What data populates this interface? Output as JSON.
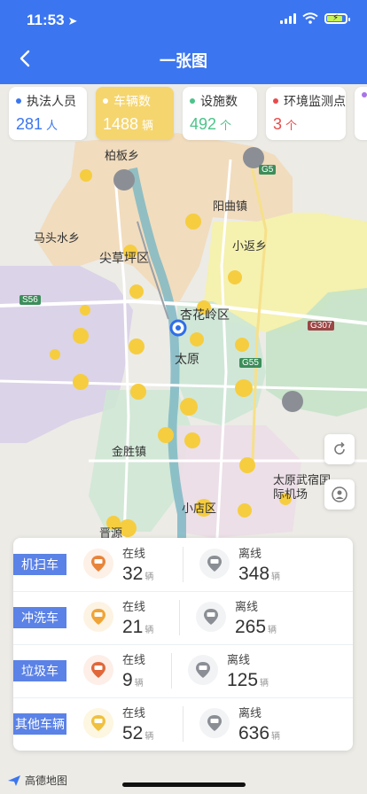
{
  "status_bar": {
    "time": "11:53"
  },
  "header": {
    "title": "一张图"
  },
  "stats": [
    {
      "label": "执法人员",
      "value": "281",
      "unit": "人",
      "dot_color": "#3b76f0",
      "value_color": "#3b76f0"
    },
    {
      "label": "车辆数",
      "value": "1488",
      "unit": "辆",
      "dot_color": "#ffffff",
      "value_color": "#ffffff"
    },
    {
      "label": "设施数",
      "value": "492",
      "unit": "个",
      "dot_color": "#4cc38a",
      "value_color": "#4cc38a"
    },
    {
      "label": "环境监测点",
      "value": "3",
      "unit": "个",
      "dot_color": "#e84b4b",
      "value_color": "#e84b4b"
    }
  ],
  "map_labels": {
    "bobanxiang": "柏板乡",
    "matoushui": "马头水乡",
    "jiancaoping": "尖草坪区",
    "xiaofan": "小返乡",
    "xinghualing": "杏花岭区",
    "taiyuan": "太原",
    "jinsheng": "金胜镇",
    "xiaodian": "小店区",
    "airport": "太原武宿国际机场",
    "jinci": "晋源",
    "yangqu": "阳曲镇",
    "road_s56": "S56",
    "road_g5": "G5",
    "road_g307": "G307",
    "road_g55": "G55"
  },
  "map_logo": "高德地图",
  "vehicle_panel": {
    "online_label": "在线",
    "offline_label": "离线",
    "unit": "辆",
    "rows": [
      {
        "label": "机扫车",
        "online": "32",
        "offline": "348",
        "icon_color": "#e8843a"
      },
      {
        "label": "冲洗车",
        "online": "21",
        "offline": "265",
        "icon_color": "#f0a436"
      },
      {
        "label": "垃圾车",
        "online": "9",
        "offline": "125",
        "icon_color": "#e0673a"
      },
      {
        "label": "其他车辆",
        "online": "52",
        "offline": "636",
        "icon_color": "#f0c040"
      }
    ]
  }
}
